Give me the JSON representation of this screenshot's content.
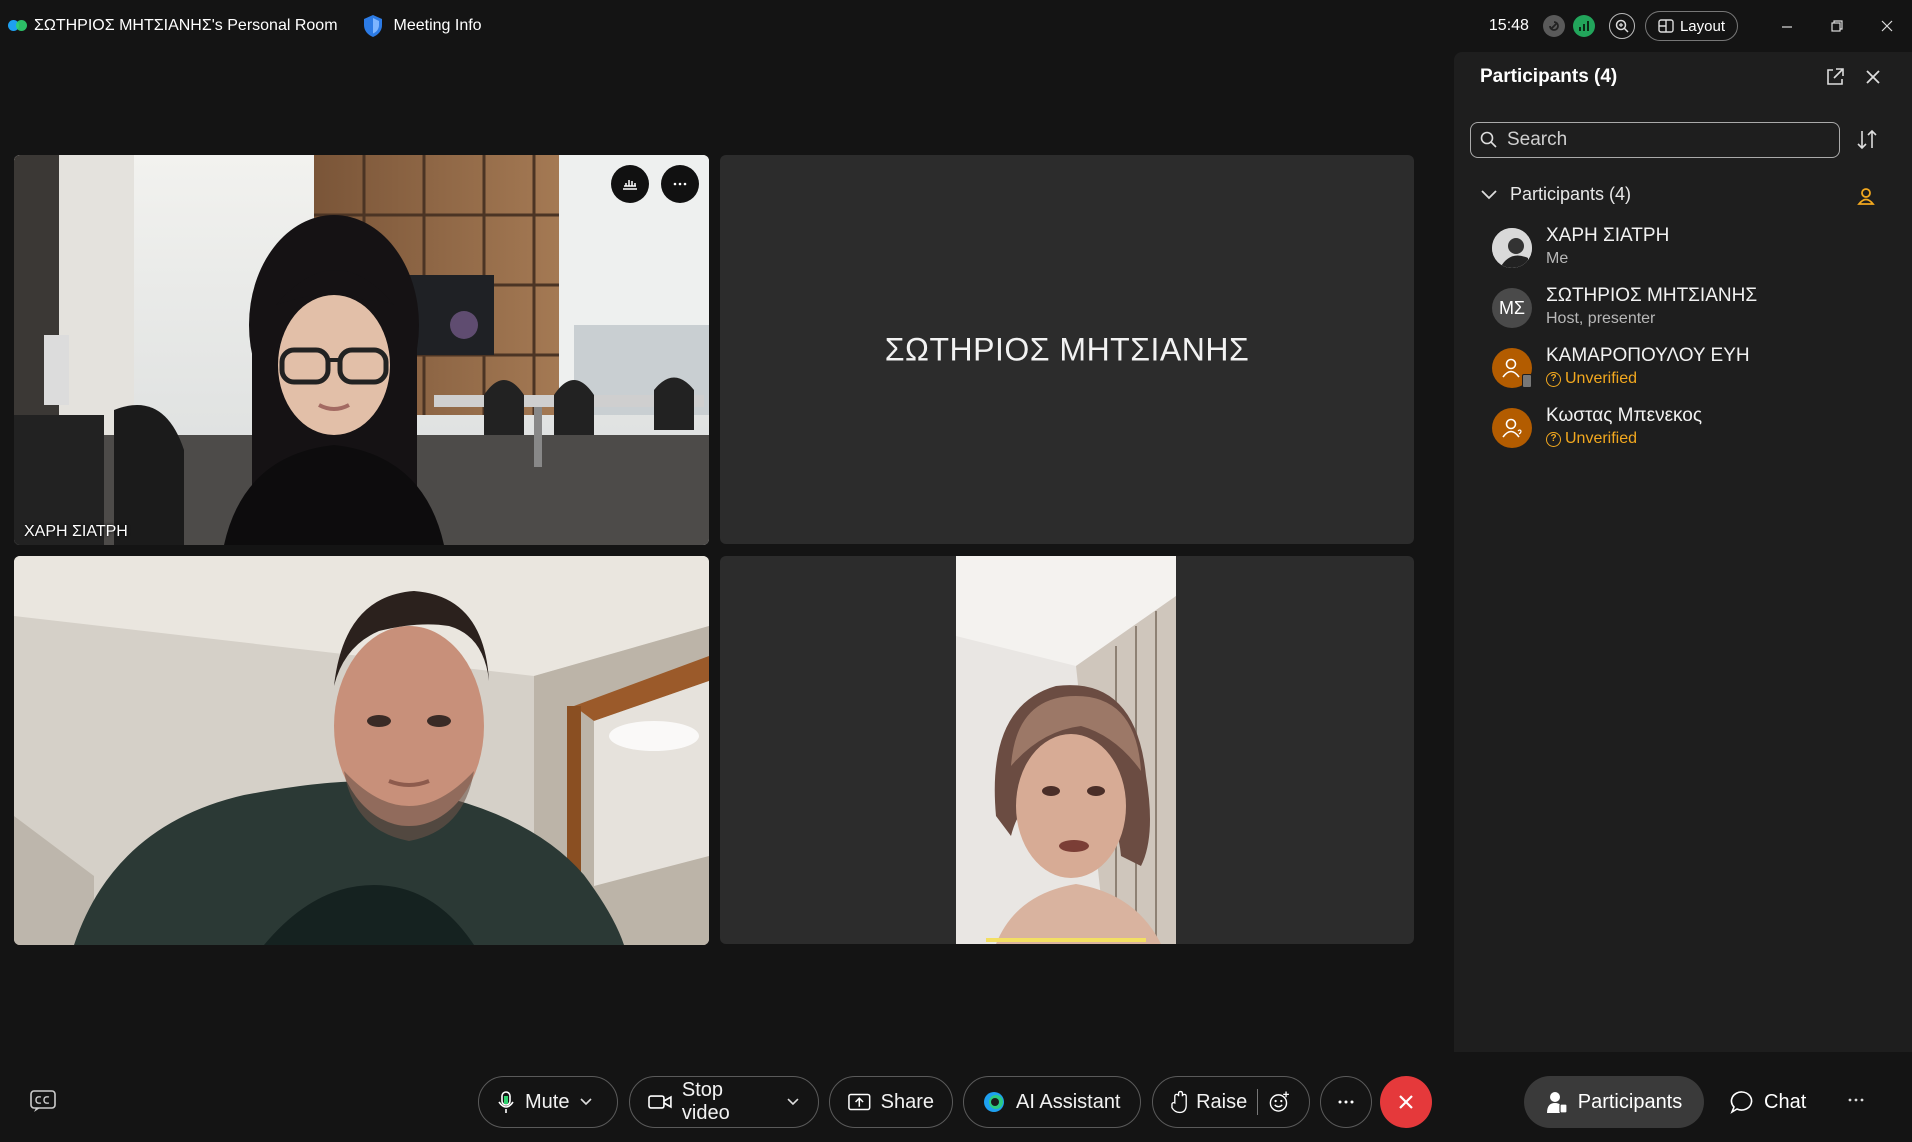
{
  "window": {
    "title": "ΣΩΤΗΡΙΟΣ ΜΗΤΣΙΑΝΗΣ's Personal Room",
    "meeting_info_label": "Meeting Info",
    "time": "15:48",
    "layout_label": "Layout"
  },
  "tiles": [
    {
      "name": "ΧΑΡΗ ΣΙΑΤΡΗ",
      "type": "video"
    },
    {
      "name": "ΣΩΤΗΡΙΟΣ ΜΗΤΣΙΑΝΗΣ",
      "type": "name-only"
    },
    {
      "name": "",
      "type": "video"
    },
    {
      "name": "",
      "type": "video-portrait"
    }
  ],
  "panel": {
    "title": "Participants (4)",
    "search_placeholder": "Search",
    "section_label": "Participants (4)",
    "participants": [
      {
        "name": "ΧΑΡΗ ΣΙΑΤΡΗ",
        "sub": "Me",
        "avatar": "photo"
      },
      {
        "name": "ΣΩΤΗΡΙΟΣ ΜΗΤΣΙΑΝΗΣ",
        "sub": "Host, presenter",
        "avatar": "initials",
        "initials": "ΜΣ"
      },
      {
        "name": "ΚΑΜΑΡΟΠΟΥΛΟΥ ΕΥΗ",
        "sub": "Unverified",
        "avatar": "guest-phone"
      },
      {
        "name": "Κωστας Μπενεκος",
        "sub": "Unverified",
        "avatar": "guest"
      }
    ]
  },
  "toolbar": {
    "mute_label": "Mute",
    "stop_video_label": "Stop video",
    "share_label": "Share",
    "ai_label": "AI Assistant",
    "raise_label": "Raise",
    "participants_label": "Participants",
    "chat_label": "Chat"
  },
  "colors": {
    "background": "#141414",
    "panel": "#1e1e1e",
    "tile": "#2c2c2c",
    "end_call": "#e5393b",
    "unverified": "#f2a81f",
    "guest_avatar": "#b35c00"
  }
}
